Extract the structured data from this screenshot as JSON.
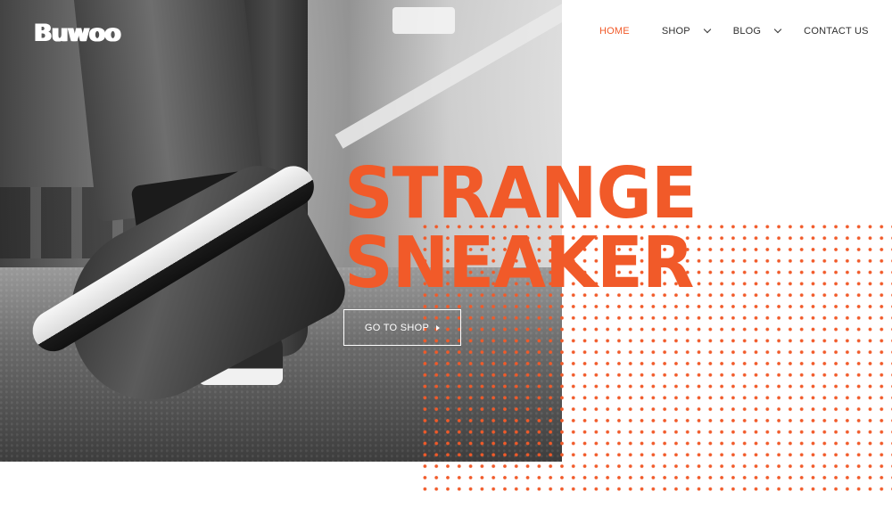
{
  "brand": {
    "logo": "Buwoo",
    "accent": "#f15a29"
  },
  "nav": {
    "items": [
      {
        "label": "HOME",
        "active": true
      },
      {
        "label": "SHOP",
        "has_dropdown": true
      },
      {
        "label": "BLOG",
        "has_dropdown": true
      },
      {
        "label": "CONTACT US"
      }
    ]
  },
  "hero": {
    "headline_line1": "STRANGE",
    "headline_line2": "SNEAKER",
    "cta_label": "GO TO SHOP",
    "cta_icon": "caret-right-icon"
  }
}
